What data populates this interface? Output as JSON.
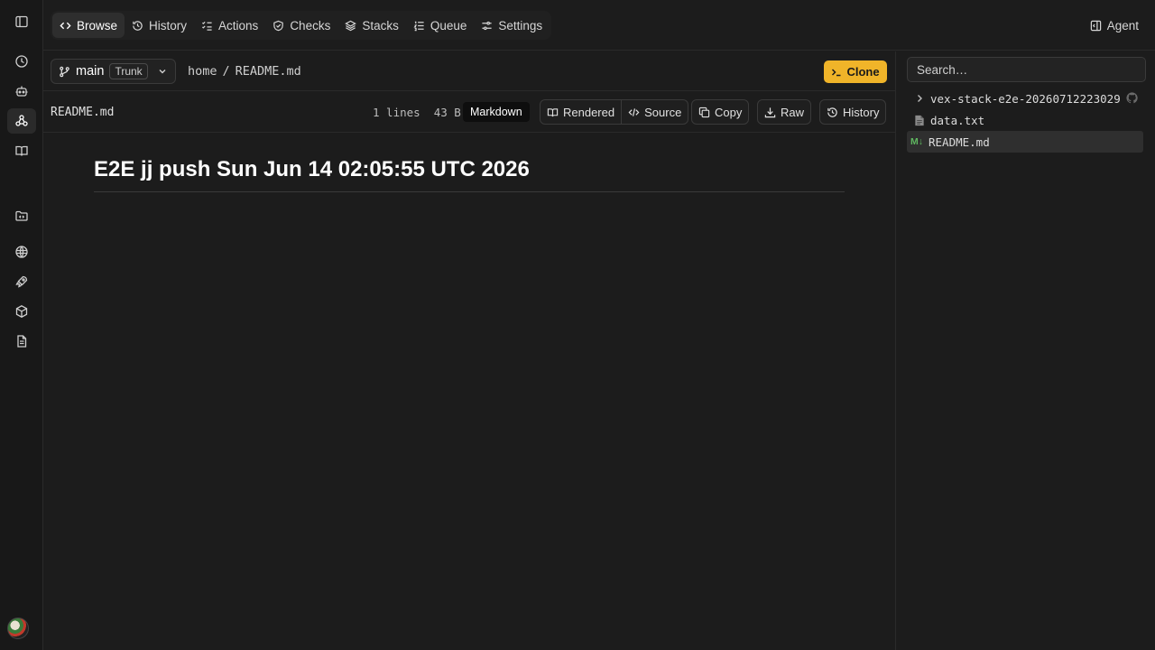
{
  "nav": {
    "tabs": [
      {
        "label": "Browse"
      },
      {
        "label": "History"
      },
      {
        "label": "Actions"
      },
      {
        "label": "Checks"
      },
      {
        "label": "Stacks"
      },
      {
        "label": "Queue"
      },
      {
        "label": "Settings"
      }
    ],
    "agent_label": "Agent"
  },
  "rail_icons": [
    "sidebar-toggle-icon",
    "clock-icon",
    "robot-icon",
    "graph-icon",
    "book-icon",
    "folder-code-icon",
    "globe-icon",
    "rocket-icon",
    "package-icon",
    "document-icon"
  ],
  "repo": {
    "branch": "main",
    "branch_tag": "Trunk",
    "breadcrumb_root": "home",
    "breadcrumb_sep": "/",
    "breadcrumb_file": "README.md",
    "clone_label": "Clone"
  },
  "file": {
    "name": "README.md",
    "meta": "1 lines  43 B",
    "language": "Markdown",
    "view_rendered": "Rendered",
    "view_source": "Source",
    "copy_label": "Copy",
    "raw_label": "Raw",
    "history_label": "History"
  },
  "content": {
    "heading": "E2E jj push Sun Jun 14 02:05:55 UTC 2026"
  },
  "sidebar": {
    "search_placeholder": "Search…",
    "tree": [
      {
        "label": "vex-stack-e2e-20260712223029",
        "kind": "folder"
      },
      {
        "label": "data.txt",
        "kind": "file"
      },
      {
        "label": "README.md",
        "kind": "markdown",
        "badge": "M↓"
      }
    ]
  },
  "colors": {
    "accent": "#f0b429",
    "background": "#1c1c1c",
    "markdown_badge": "#5fb760"
  }
}
